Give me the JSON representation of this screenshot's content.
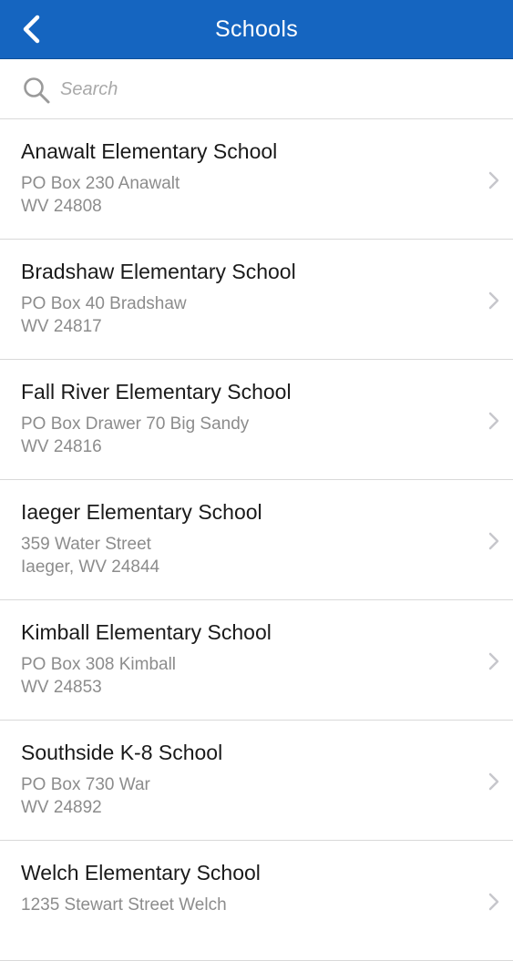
{
  "header": {
    "title": "Schools",
    "back_icon": "chevron-left-icon"
  },
  "search": {
    "placeholder": "Search",
    "value": ""
  },
  "colors": {
    "nav_bar": "#1565c0",
    "title_text": "#ffffff",
    "primary_text": "#1a1a1a",
    "secondary_text": "#8c8c8c",
    "divider": "#d9d9d9",
    "chevron": "#c7c7cc"
  },
  "schools": [
    {
      "name": "Anawalt Elementary School",
      "address_line1": "PO Box 230 Anawalt",
      "address_line2": "WV 24808"
    },
    {
      "name": "Bradshaw Elementary School",
      "address_line1": "PO Box 40 Bradshaw",
      "address_line2": "WV 24817"
    },
    {
      "name": "Fall River Elementary School",
      "address_line1": "PO Box Drawer 70 Big Sandy",
      "address_line2": "WV 24816"
    },
    {
      "name": "Iaeger Elementary School",
      "address_line1": "359 Water Street",
      "address_line2": "Iaeger, WV 24844"
    },
    {
      "name": "Kimball Elementary School",
      "address_line1": "PO Box 308 Kimball",
      "address_line2": "WV 24853"
    },
    {
      "name": "Southside K-8 School",
      "address_line1": "PO Box 730 War",
      "address_line2": "WV 24892"
    },
    {
      "name": "Welch Elementary School",
      "address_line1": "1235 Stewart Street Welch",
      "address_line2": ""
    }
  ]
}
